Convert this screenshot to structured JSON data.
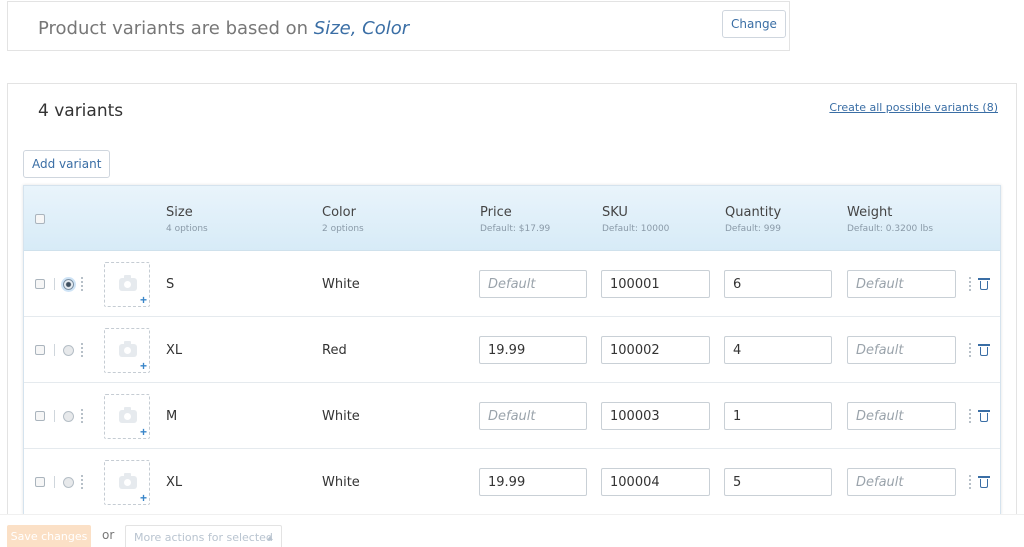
{
  "top_bar": {
    "prefix": "Product variants are based on ",
    "options": "Size, Color",
    "change_label": "Change"
  },
  "panel": {
    "title": "4 variants",
    "create_all_label": "Create all possible variants (8)",
    "add_variant_label": "Add variant"
  },
  "table": {
    "headers": {
      "size": {
        "label": "Size",
        "sub": "4 options"
      },
      "color": {
        "label": "Color",
        "sub": "2 options"
      },
      "price": {
        "label": "Price",
        "sub": "Default: $17.99"
      },
      "sku": {
        "label": "SKU",
        "sub": "Default: 10000"
      },
      "quantity": {
        "label": "Quantity",
        "sub": "Default: 999"
      },
      "weight": {
        "label": "Weight",
        "sub": "Default: 0.3200 lbs"
      }
    },
    "placeholder": "Default",
    "rows": [
      {
        "size": "S",
        "color": "White",
        "price": "",
        "sku": "100001",
        "quantity": "6",
        "weight": "",
        "selected": true
      },
      {
        "size": "XL",
        "color": "Red",
        "price": "19.99",
        "sku": "100002",
        "quantity": "4",
        "weight": "",
        "selected": false
      },
      {
        "size": "M",
        "color": "White",
        "price": "",
        "sku": "100003",
        "quantity": "1",
        "weight": "",
        "selected": false
      },
      {
        "size": "XL",
        "color": "White",
        "price": "19.99",
        "sku": "100004",
        "quantity": "5",
        "weight": "",
        "selected": false
      }
    ]
  },
  "footer": {
    "save_label": "Save changes",
    "or_label": "or",
    "more_actions_label": "More actions for selected"
  },
  "colors": {
    "accent": "#3a6ea5",
    "header_bg": "#d7ebf7",
    "save_disabled": "#fbe0c6"
  }
}
